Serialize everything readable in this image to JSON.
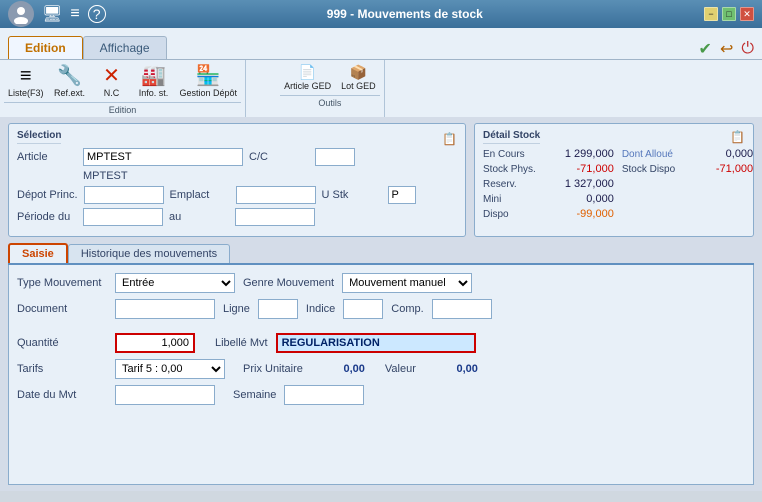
{
  "titlebar": {
    "title": "999 - Mouvements de stock",
    "minimize": "−",
    "maximize": "□",
    "close": "✕"
  },
  "tabs": {
    "edition_label": "Edition",
    "affichage_label": "Affichage"
  },
  "tab_actions": {
    "check": "✔",
    "back": "↩",
    "power": "⏻"
  },
  "toolbar": {
    "edition_group": "Edition",
    "outils_group": "Outils",
    "liste_label": "Liste(F3)",
    "refext_label": "Ref.ext.",
    "nc_label": "N.C",
    "infost_label": "Info. st.",
    "gestion_depot_label": "Gestion Dépôt",
    "article_ged_label": "Article GED",
    "lot_ged_label": "Lot GED"
  },
  "selection": {
    "title": "Sélection",
    "article_label": "Article",
    "article_value": "MPTEST",
    "cc_label": "C/C",
    "cc_value": "",
    "article_desc": "MPTEST",
    "depot_label": "Dépot Princ.",
    "depot_value": "",
    "emplact_label": "Emplact",
    "emplact_value": "",
    "ustk_label": "U Stk",
    "ustk_value": "P",
    "periode_label": "Période du",
    "periode_value": "",
    "au_label": "au",
    "au_value": ""
  },
  "detail_stock": {
    "title": "Détail Stock",
    "en_cours_label": "En Cours",
    "en_cours_value": "1 299,000",
    "dont_alloue_label": "Dont Alloué",
    "dont_alloue_value": "0,000",
    "stock_phys_label": "Stock Phys.",
    "stock_phys_value": "-71,000",
    "stock_dispo_label": "Stock Dispo",
    "stock_dispo_value": "-71,000",
    "reserv_label": "Reserv.",
    "reserv_value": "1 327,000",
    "mini_label": "Mini",
    "mini_value": "0,000",
    "dispo_label": "Dispo",
    "dispo_value": "-99,000"
  },
  "lower_tabs": {
    "saisie_label": "Saisie",
    "historique_label": "Historique des mouvements"
  },
  "saisie_form": {
    "type_mouvement_label": "Type Mouvement",
    "type_mouvement_value": "Entrée",
    "genre_mouvement_label": "Genre Mouvement",
    "genre_mouvement_value": "Mouvement manuel",
    "document_label": "Document",
    "document_value": "",
    "ligne_label": "Ligne",
    "ligne_value": "",
    "indice_label": "Indice",
    "indice_value": "",
    "comp_label": "Comp.",
    "comp_value": "",
    "quantite_label": "Quantité",
    "quantite_value": "1,000",
    "libelle_label": "Libellé Mvt",
    "libelle_value": "REGULARISATION",
    "tarifs_label": "Tarifs",
    "tarifs_value": "Tarif 5 :",
    "tarif_amount": "0,00",
    "prix_unitaire_label": "Prix Unitaire",
    "prix_unitaire_value": "0,00",
    "valeur_label": "Valeur",
    "valeur_value": "0,00",
    "date_mvt_label": "Date du Mvt",
    "date_mvt_value": "",
    "semaine_label": "Semaine",
    "semaine_value": ""
  }
}
